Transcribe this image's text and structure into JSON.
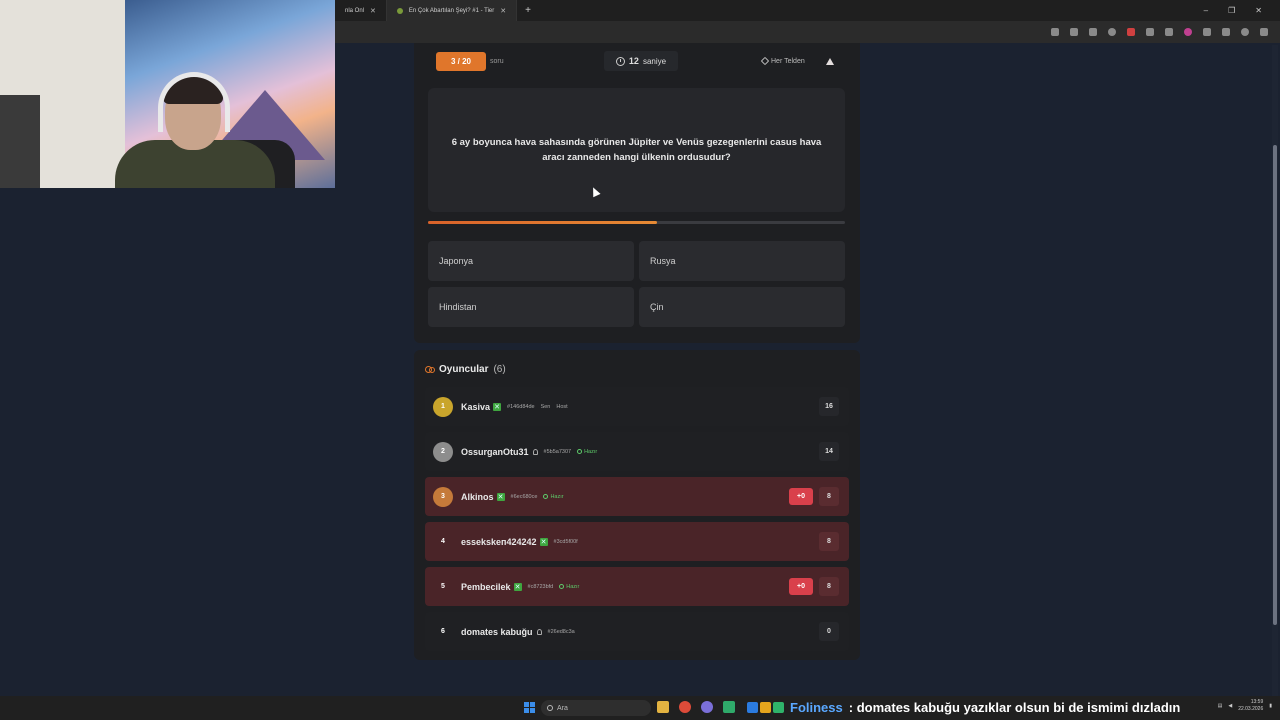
{
  "browser": {
    "tabs": [
      {
        "label": "nla Onl",
        "active": false
      },
      {
        "label": "En Çok Abartılan Şeyi? #1 - Tier",
        "active": true
      }
    ],
    "new_tab": "+",
    "window_controls": [
      "–",
      "❐",
      "✕"
    ]
  },
  "game": {
    "question_counter": "3 / 20",
    "question_word": "soru",
    "timer_value": "12",
    "timer_unit": "saniye",
    "category": "Her Telden",
    "question_text": "6 ay boyunca hava sahasında görünen Jüpiter ve Venüs gezegenlerini casus hava aracı zanneden hangi ülkenin ordusudur?",
    "progress_fraction": 0.55,
    "answers": [
      "Japonya",
      "Rusya",
      "Hindistan",
      "Çin"
    ]
  },
  "players": {
    "title": "Oyuncular",
    "count": "(6)",
    "rows": [
      {
        "rank": "1",
        "name": "Kasiva",
        "id": "#146d84de",
        "you": "Sen",
        "host": "Host",
        "ready": "",
        "delta": "",
        "score": "16",
        "highlight": false,
        "rank_color": "#c9a52c",
        "kick": true
      },
      {
        "rank": "2",
        "name": "OssurganOtu31",
        "id": "#5b5a7307",
        "you": "",
        "host": "",
        "ready": "Hazır",
        "delta": "",
        "score": "14",
        "highlight": false,
        "rank_color": "#8d8d8d",
        "kick": false
      },
      {
        "rank": "3",
        "name": "Alkinos",
        "id": "#6ec680ce",
        "you": "",
        "host": "",
        "ready": "Hazır",
        "delta": "+0",
        "score": "8",
        "highlight": true,
        "rank_color": "#c57a3a",
        "kick": true
      },
      {
        "rank": "4",
        "name": "essekskeп424242",
        "id": "#3cd5f00f",
        "you": "",
        "host": "",
        "ready": "",
        "delta": "",
        "score": "8",
        "highlight": true,
        "rank_color": "",
        "kick": true
      },
      {
        "rank": "5",
        "name": "Pembecilek",
        "id": "#c8723bfd",
        "you": "",
        "host": "",
        "ready": "Hazır",
        "delta": "+0",
        "score": "8",
        "highlight": true,
        "rank_color": "",
        "kick": true
      },
      {
        "rank": "6",
        "name": "domates kabuğu",
        "id": "#26ed8c3a",
        "you": "",
        "host": "",
        "ready": "",
        "delta": "",
        "score": "0",
        "highlight": false,
        "rank_color": "",
        "kick": false
      }
    ]
  },
  "taskbar": {
    "search_placeholder": "Ara",
    "chat_user": "Foliness",
    "chat_message": ": domates kabuğu yazıklar olsun bi de ismimi dızladın",
    "time": "13:59",
    "date": "22.03.2026"
  },
  "colors": {
    "accent": "#e0762b",
    "ready_green": "#5ecb6a",
    "delta_red": "#d9404b",
    "highlight_row": "#4a2428"
  }
}
